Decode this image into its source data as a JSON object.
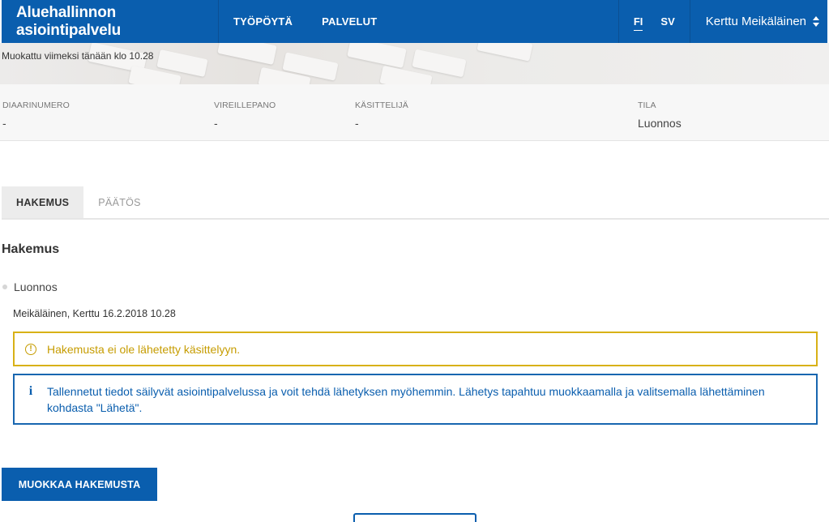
{
  "header": {
    "app_title": "Aluehallinnon asiointipalvelu",
    "nav": [
      "TYÖPÖYTÄ",
      "PALVELUT"
    ],
    "languages": [
      "FI",
      "SV"
    ],
    "active_language": "FI",
    "user_name": "Kerttu Meikäläinen",
    "brand_color": "#0a5eae"
  },
  "hero": {
    "modified_text": "Muokattu viimeksi tänään klo 10.28"
  },
  "info": {
    "diary": {
      "label": "DIAARINUMERO",
      "value": "-"
    },
    "pending": {
      "label": "VIREILLEPANO",
      "value": "-"
    },
    "handler": {
      "label": "KÄSITTELIJÄ",
      "value": "-"
    },
    "state": {
      "label": "TILA",
      "value": "Luonnos"
    }
  },
  "tabs": [
    {
      "label": "HAKEMUS",
      "active": true
    },
    {
      "label": "PÄÄTÖS",
      "active": false
    }
  ],
  "section": {
    "title": "Hakemus",
    "status": "Luonnos",
    "meta": "Meikäläinen, Kerttu 16.2.2018 10.28"
  },
  "alerts": {
    "warning": {
      "icon": "warning-icon",
      "text": "Hakemusta ei ole lähetetty käsittelyyn.",
      "color": "#d8b116"
    },
    "info": {
      "icon": "info-icon",
      "text": "Tallennetut tiedot säilyvät asiointipalvelussa ja voit tehdä lähetyksen myöhemmin. Lähetys tapahtuu muokkaamalla ja valitsemalla lähettäminen kohdasta \"Lähetä\".",
      "color": "#1866b0"
    }
  },
  "actions": {
    "edit_label": "MUOKKAA HAKEMUSTA"
  }
}
